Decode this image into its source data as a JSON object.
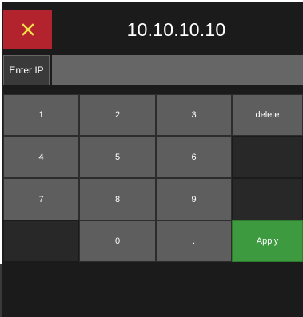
{
  "header": {
    "close_icon": "close-icon",
    "close_color": "#b2232e",
    "close_glyph_color": "#f5e04a",
    "title": "10.10.10.10"
  },
  "ip_entry": {
    "label": "Enter IP",
    "value": ""
  },
  "keypad": {
    "keys": [
      {
        "id": "1",
        "label": "1"
      },
      {
        "id": "2",
        "label": "2"
      },
      {
        "id": "3",
        "label": "3"
      },
      {
        "id": "delete",
        "label": "delete"
      },
      {
        "id": "4",
        "label": "4"
      },
      {
        "id": "5",
        "label": "5"
      },
      {
        "id": "6",
        "label": "6"
      },
      {
        "id": "7",
        "label": "7"
      },
      {
        "id": "8",
        "label": "8"
      },
      {
        "id": "9",
        "label": "9"
      },
      {
        "id": "0",
        "label": "0"
      },
      {
        "id": "dot",
        "label": "."
      },
      {
        "id": "apply",
        "label": "Apply"
      }
    ],
    "apply_color": "#3d9a3e"
  }
}
